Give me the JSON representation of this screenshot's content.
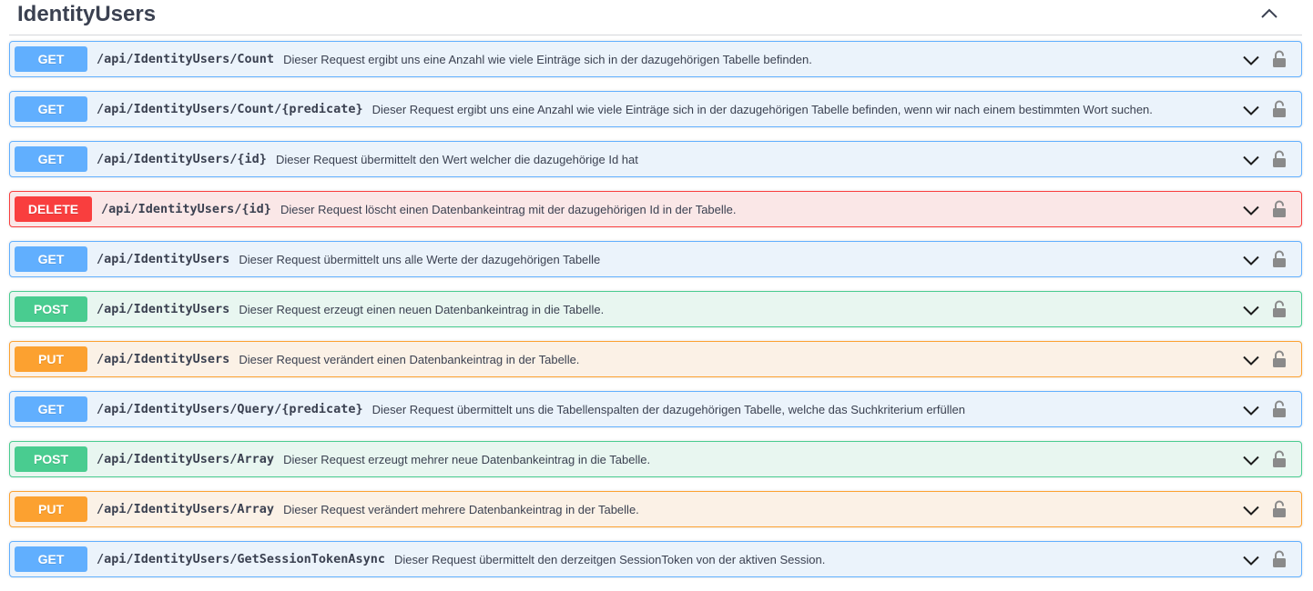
{
  "section": {
    "title": "IdentityUsers"
  },
  "operations": [
    {
      "method": "GET",
      "path": "/api/IdentityUsers/Count",
      "summary": "Dieser Request ergibt uns eine Anzahl wie viele Einträge sich in der dazugehörigen Tabelle befinden."
    },
    {
      "method": "GET",
      "path": "/api/IdentityUsers/Count/{predicate}",
      "summary": "Dieser Request ergibt uns eine Anzahl wie viele Einträge sich in der dazugehörigen Tabelle befinden, wenn wir nach einem bestimmten Wort suchen."
    },
    {
      "method": "GET",
      "path": "/api/IdentityUsers/{id}",
      "summary": "Dieser Request übermittelt den Wert welcher die dazugehörige Id hat"
    },
    {
      "method": "DELETE",
      "path": "/api/IdentityUsers/{id}",
      "summary": "Dieser Request löscht einen Datenbankeintrag mit der dazugehörigen Id in der Tabelle."
    },
    {
      "method": "GET",
      "path": "/api/IdentityUsers",
      "summary": "Dieser Request übermittelt uns alle Werte der dazugehörigen Tabelle"
    },
    {
      "method": "POST",
      "path": "/api/IdentityUsers",
      "summary": "Dieser Request erzeugt einen neuen Datenbankeintrag in die Tabelle."
    },
    {
      "method": "PUT",
      "path": "/api/IdentityUsers",
      "summary": "Dieser Request verändert einen Datenbankeintrag in der Tabelle."
    },
    {
      "method": "GET",
      "path": "/api/IdentityUsers/Query/{predicate}",
      "summary": "Dieser Request übermittelt uns die Tabellenspalten der dazugehörigen Tabelle, welche das Suchkriterium erfüllen"
    },
    {
      "method": "POST",
      "path": "/api/IdentityUsers/Array",
      "summary": "Dieser Request erzeugt mehrer neue Datenbankeintrag in die Tabelle."
    },
    {
      "method": "PUT",
      "path": "/api/IdentityUsers/Array",
      "summary": "Dieser Request verändert mehrere Datenbankeintrag in der Tabelle."
    },
    {
      "method": "GET",
      "path": "/api/IdentityUsers/GetSessionTokenAsync",
      "summary": "Dieser Request übermittelt den derzeitgen SessionToken von der aktiven Session."
    }
  ],
  "icons": {
    "collapse": "chevron-up-icon",
    "expand": "chevron-down-icon",
    "auth": "lock-open-icon"
  },
  "colors": {
    "get": "#61affe",
    "delete": "#f93e3e",
    "post": "#49cc90",
    "put": "#fca130"
  }
}
